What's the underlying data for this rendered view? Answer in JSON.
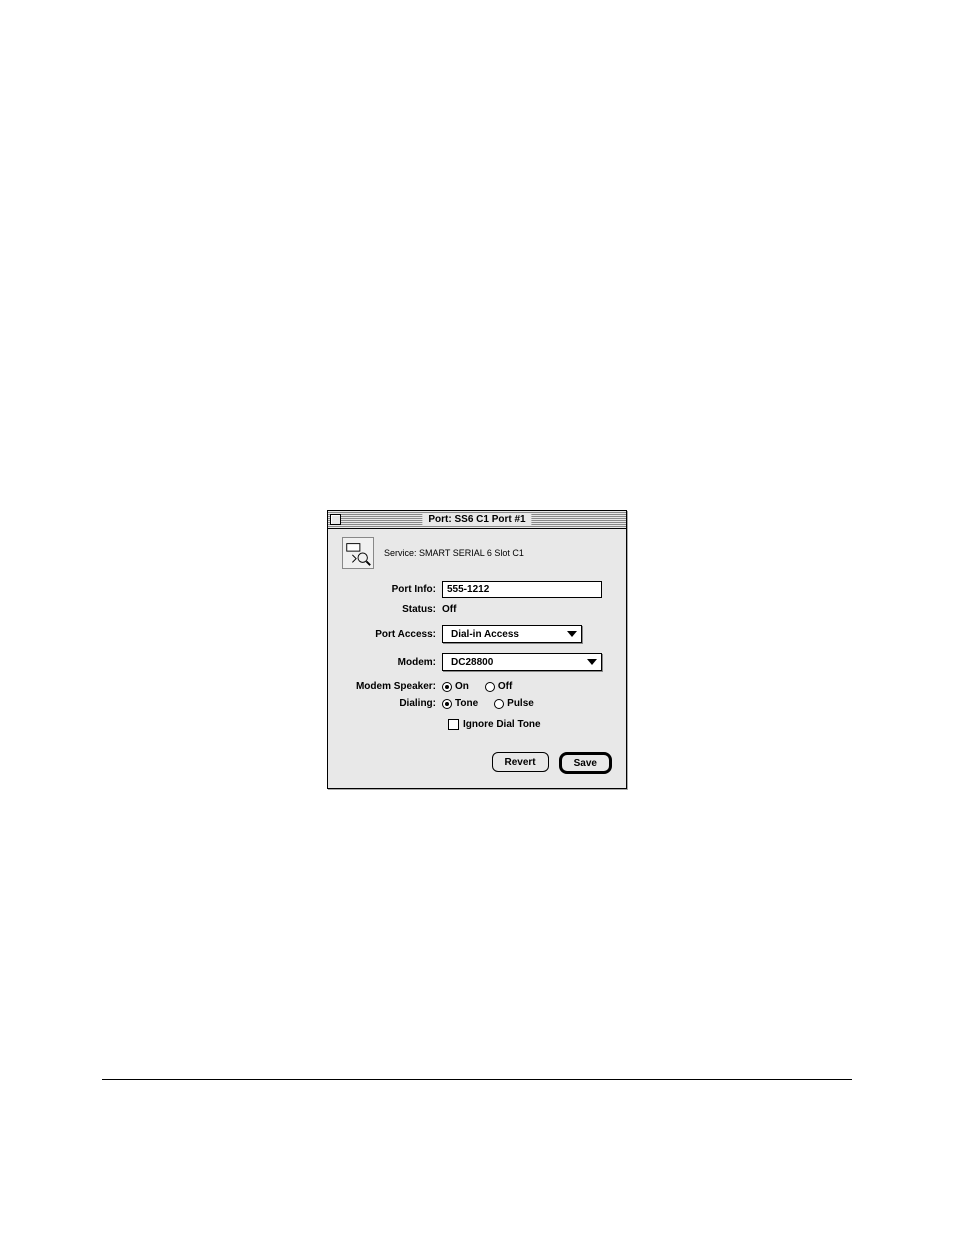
{
  "window": {
    "title": "Port: SS6 C1 Port #1"
  },
  "header": {
    "service_label": "Service:",
    "service_value": "SMART SERIAL 6 Slot C1"
  },
  "form": {
    "port_info_label": "Port Info:",
    "port_info_value": "555-1212",
    "status_label": "Status:",
    "status_value": "Off",
    "port_access_label": "Port Access:",
    "port_access_value": "Dial-in Access",
    "modem_label": "Modem:",
    "modem_value": "DC28800",
    "modem_speaker_label": "Modem Speaker:",
    "speaker_on": "On",
    "speaker_off": "Off",
    "dialing_label": "Dialing:",
    "dialing_tone": "Tone",
    "dialing_pulse": "Pulse",
    "ignore_dial_tone_label": "Ignore Dial Tone"
  },
  "buttons": {
    "revert": "Revert",
    "save": "Save"
  }
}
